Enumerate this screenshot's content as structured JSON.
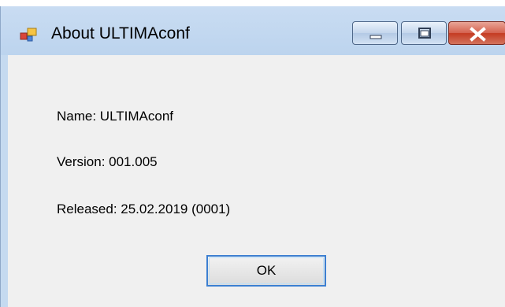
{
  "window": {
    "title": "About ULTIMAconf",
    "icon": "application-icon",
    "controls": [
      "minimize-icon",
      "maximize-icon",
      "close-icon"
    ]
  },
  "info": {
    "name": "Name: ULTIMAconf",
    "version": "Version: 001.005",
    "released": "Released: 25.02.2019 (0001)"
  },
  "buttons": {
    "ok_label": "OK"
  },
  "colors": {
    "titlebar": "#c5daf0",
    "client": "#f0f0f0",
    "close_button": "#c43b22",
    "focus_border": "#3c7fd1"
  }
}
